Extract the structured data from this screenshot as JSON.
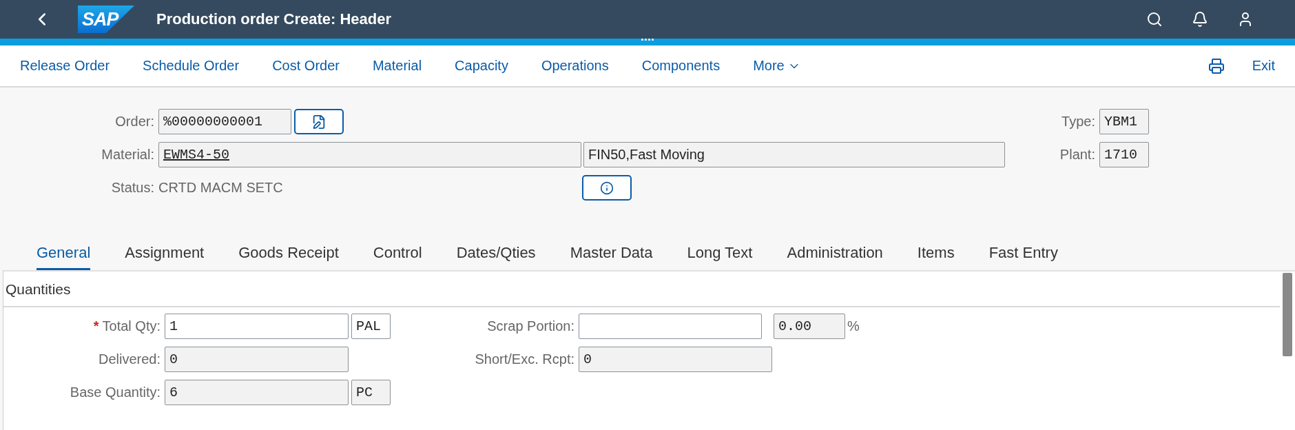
{
  "shell": {
    "logo": "SAP",
    "title": "Production order Create: Header"
  },
  "toolbar": {
    "items": [
      {
        "label": "Release Order",
        "kind": "text"
      },
      {
        "label": "Schedule Order",
        "kind": "text"
      },
      {
        "label": "Cost Order",
        "kind": "text"
      },
      {
        "label": "Material",
        "kind": "text"
      },
      {
        "label": "Capacity",
        "kind": "text"
      },
      {
        "label": "Operations",
        "kind": "text"
      },
      {
        "label": "Components",
        "kind": "text"
      },
      {
        "label": "More",
        "kind": "menu"
      }
    ],
    "exit": "Exit"
  },
  "header": {
    "order": {
      "label": "Order:",
      "value": "%00000000001",
      "editable": false
    },
    "material": {
      "label": "Material:",
      "value": "EWMS4-50",
      "link": true,
      "editable": false,
      "description": "FIN50,Fast Moving"
    },
    "status": {
      "label": "Status:",
      "value": "CRTD MACM SETC"
    },
    "type": {
      "label": "Type:",
      "value": "YBM1",
      "editable": false
    },
    "plant": {
      "label": "Plant:",
      "value": "1710",
      "editable": false
    }
  },
  "tabs": [
    {
      "label": "General",
      "selected": true
    },
    {
      "label": "Assignment",
      "selected": false
    },
    {
      "label": "Goods Receipt",
      "selected": false
    },
    {
      "label": "Control",
      "selected": false
    },
    {
      "label": "Dates/Qties",
      "selected": false
    },
    {
      "label": "Master Data",
      "selected": false
    },
    {
      "label": "Long Text",
      "selected": false
    },
    {
      "label": "Administration",
      "selected": false
    },
    {
      "label": "Items",
      "selected": false
    },
    {
      "label": "Fast Entry",
      "selected": false
    }
  ],
  "quantities": {
    "title": "Quantities",
    "left": [
      {
        "label": "Total Qty:",
        "required_mark": "*",
        "value": "1",
        "editable": true,
        "unit": "PAL",
        "unit_editable": true
      },
      {
        "label": "Delivered:",
        "value": "0",
        "editable": false
      },
      {
        "label": "Base Quantity:",
        "value": "6",
        "editable": false,
        "unit": "PC",
        "unit_editable": false
      }
    ],
    "right": [
      {
        "label": "Scrap Portion:",
        "editable": true,
        "percent": "0.00",
        "percent_sign": "%"
      },
      {
        "label": "Short/Exc. Rcpt:",
        "value": "0",
        "editable": false
      }
    ]
  }
}
